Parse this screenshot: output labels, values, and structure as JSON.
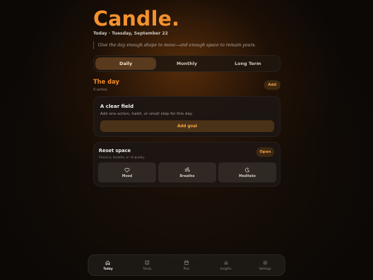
{
  "header": {
    "title": "Candle.",
    "date": "Today · Tuesday, September 22",
    "quote": "Give the day enough shape to move—and enough space to remain yours."
  },
  "tabs": [
    {
      "label": "Daily",
      "active": true
    },
    {
      "label": "Monthly",
      "active": false
    },
    {
      "label": "Long Term",
      "active": false
    }
  ],
  "section": {
    "title": "The day",
    "subtitle": "0 active",
    "add_label": "Add"
  },
  "empty_card": {
    "title": "A clear field",
    "description": "Add one action, habit, or small step for this day.",
    "button_label": "Add goal"
  },
  "reset_card": {
    "title": "Reset space",
    "subtitle": "Check in, breathe, or sit quietly.",
    "open_label": "Open",
    "tiles": [
      {
        "label": "Mood",
        "icon": "heart-icon"
      },
      {
        "label": "Breathe",
        "icon": "wind-icon"
      },
      {
        "label": "Meditate",
        "icon": "moon-icon"
      }
    ]
  },
  "nav": [
    {
      "label": "Today",
      "icon": "home-icon",
      "active": true
    },
    {
      "label": "Study",
      "icon": "book-icon",
      "active": false
    },
    {
      "label": "Plan",
      "icon": "calendar-icon",
      "active": false
    },
    {
      "label": "Insights",
      "icon": "bar-chart-icon",
      "active": false
    },
    {
      "label": "Settings",
      "icon": "gear-icon",
      "active": false
    }
  ],
  "colors": {
    "accent": "#f3922e",
    "background": "#0b0806",
    "card": "#1c1612"
  }
}
